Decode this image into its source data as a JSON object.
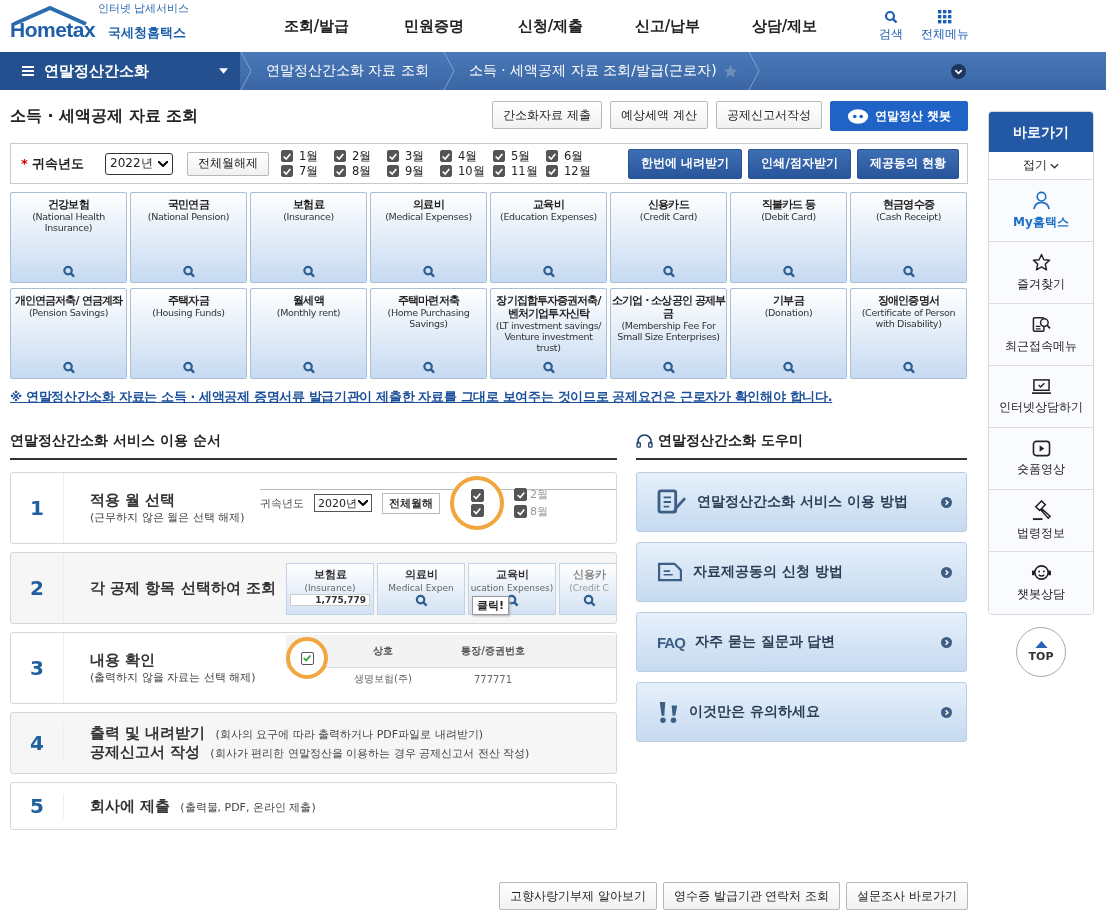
{
  "header": {
    "logo": {
      "tagline": "인터넷 납세서비스",
      "brand": "Hometax",
      "name": "국세청홈택스"
    },
    "nav": [
      "조회/발급",
      "민원증명",
      "신청/제출",
      "신고/납부",
      "상담/제보"
    ],
    "utilities": [
      {
        "label": "검색",
        "kind": "search"
      },
      {
        "label": "전체메뉴",
        "kind": "grid"
      }
    ]
  },
  "breadcrumb": {
    "menu": "연말정산간소화",
    "items": [
      "연말정산간소화 자료 조회",
      "소득 · 세액공제 자료 조회/발급(근로자)"
    ]
  },
  "page_title": "소득 · 세액공제 자료 조회",
  "actions": [
    {
      "label": "간소화자료 제출",
      "kind": "plain"
    },
    {
      "label": "예상세액 계산",
      "kind": "plain"
    },
    {
      "label": "공제신고서작성",
      "kind": "plain"
    },
    {
      "label": "연말정산 챗봇",
      "kind": "primary"
    }
  ],
  "filter": {
    "required_mark": "*",
    "label": "귀속년도",
    "year": "2022년",
    "clear_button": "전체월해제",
    "months": [
      {
        "label": "1월",
        "checked": true
      },
      {
        "label": "7월",
        "checked": true
      },
      {
        "label": "2월",
        "checked": true
      },
      {
        "label": "8월",
        "checked": true
      },
      {
        "label": "3월",
        "checked": true
      },
      {
        "label": "9월",
        "checked": true
      },
      {
        "label": "4월",
        "checked": true
      },
      {
        "label": "10월",
        "checked": true
      },
      {
        "label": "5월",
        "checked": true
      },
      {
        "label": "11월",
        "checked": true
      },
      {
        "label": "6월",
        "checked": true
      },
      {
        "label": "12월",
        "checked": true
      }
    ],
    "buttons": [
      "한번에 내려받기",
      "인쇄/점자받기",
      "제공동의 현황"
    ]
  },
  "categories": [
    {
      "title": "건강보험",
      "subtitle": "(National Health Insurance)"
    },
    {
      "title": "국민연금",
      "subtitle": "(National Pension)"
    },
    {
      "title": "보험료",
      "subtitle": "(Insurance)"
    },
    {
      "title": "의료비",
      "subtitle": "(Medical Expenses)"
    },
    {
      "title": "교육비",
      "subtitle": "(Education Expenses)"
    },
    {
      "title": "신용카드",
      "subtitle": "(Credit Card)"
    },
    {
      "title": "직불카드 등",
      "subtitle": "(Debit Card)"
    },
    {
      "title": "현금영수증",
      "subtitle": "(Cash Receipt)"
    },
    {
      "title": "개인연금저축/ 연금계좌",
      "subtitle": "(Pension Savings)"
    },
    {
      "title": "주택자금",
      "subtitle": "(Housing Funds)"
    },
    {
      "title": "월세액",
      "subtitle": "(Monthly rent)"
    },
    {
      "title": "주택마련저축",
      "subtitle": "(Home Purchasing Savings)"
    },
    {
      "title": "장기집합투자증권저축/ 벤처기업투자신탁",
      "subtitle": "(LT investment savings/ Venture investment trust)"
    },
    {
      "title": "소기업 · 소상공인 공제부금",
      "subtitle": "(Membership Fee For Small Size Enterprises)"
    },
    {
      "title": "기부금",
      "subtitle": "(Donation)"
    },
    {
      "title": "장애인증명서",
      "subtitle": "(Certificate of Person with Disability)"
    }
  ],
  "notice": "※ 연말정산간소화 자료는 소득 · 세액공제 증명서류 발급기관이 제출한 자료를 그대로 보여주는 것이므로 공제요건은 근로자가 확인해야 합니다.",
  "steps_title": "연말정산간소화 서비스 이용 순서",
  "steps": [
    {
      "number": "1",
      "kind": "stacked",
      "lines": [
        {
          "title": "적용 월 선택",
          "desc": "(근무하지 않은 월은 선택 해제)"
        }
      ],
      "illustration": {
        "kind": "months",
        "label": "귀속년도",
        "year": "2020년",
        "button": "전체월해",
        "circled_checks": [
          {
            "checked": true
          },
          {
            "checked": true
          }
        ],
        "months": [
          {
            "label": "2월",
            "checked": true
          },
          {
            "label": "8월",
            "checked": true
          }
        ]
      }
    },
    {
      "number": "2",
      "kind": "stacked",
      "lines": [
        {
          "title": "각 공제 항목 선택하여 조회"
        }
      ],
      "illustration": {
        "kind": "cards",
        "cards": [
          {
            "title": "보험료",
            "subtitle": "(Insurance)",
            "value": "1,775,779"
          },
          {
            "title": "의료비",
            "subtitle": "Medical Expen"
          },
          {
            "title": "교육비",
            "subtitle": "ucation Expenses)"
          },
          {
            "title": "신용카",
            "subtitle": "(Credit C"
          }
        ],
        "callout": "클릭!"
      }
    },
    {
      "number": "3",
      "kind": "stacked",
      "lines": [
        {
          "title": "내용 확인",
          "desc": "(출력하지 않을 자료는 선택 해제)"
        }
      ],
      "illustration": {
        "kind": "table",
        "headers": [
          "상호",
          "통장/증권번호"
        ],
        "row_checked": true,
        "row": [
          "생명보험(주)",
          "777771"
        ]
      }
    },
    {
      "number": "4",
      "kind": "inline",
      "lines": [
        {
          "title": "출력 및 내려받기",
          "desc": "(회사의 요구에 따라 출력하거나 PDF파일로 내려받기)"
        },
        {
          "title": "공제신고서 작성",
          "desc": "(회사가 편리한 연말정산을 이용하는 경우 공제신고서 전산 작성)"
        }
      ]
    },
    {
      "number": "5",
      "kind": "inline",
      "lines": [
        {
          "title": "회사에 제출",
          "desc": "(출력물, PDF, 온라인 제출)"
        }
      ]
    }
  ],
  "helper_title": "연말정산간소화 도우미",
  "helpers": [
    {
      "label": "연말정산간소화 서비스 이용 방법",
      "kind": "document-pen"
    },
    {
      "label": "자료제공동의 신청 방법",
      "kind": "document"
    },
    {
      "label": "자주 묻는 질문과 답변",
      "kind": "faq",
      "badge": "FAQ"
    },
    {
      "label": "이것만은 유의하세요",
      "kind": "warning"
    }
  ],
  "sidebar": {
    "title": "바로가기",
    "collapse": "접기",
    "items": [
      {
        "label": "My홈택스",
        "kind": "person",
        "selected": true
      },
      {
        "label": "즐겨찾기",
        "kind": "star",
        "selected": false
      },
      {
        "label": "최근접속메뉴",
        "kind": "recent",
        "selected": false
      },
      {
        "label": "인터넷상담하기",
        "kind": "laptop",
        "selected": false
      },
      {
        "label": "숏폼영상",
        "kind": "video",
        "selected": false
      },
      {
        "label": "법령정보",
        "kind": "law",
        "selected": false
      },
      {
        "label": "챗봇상담",
        "kind": "chatbot",
        "selected": false
      }
    ],
    "top": "TOP"
  },
  "footer_buttons": [
    "고향사랑기부제 알아보기",
    "영수증 발급기관 연락처 조회",
    "설문조사 바로가기"
  ]
}
